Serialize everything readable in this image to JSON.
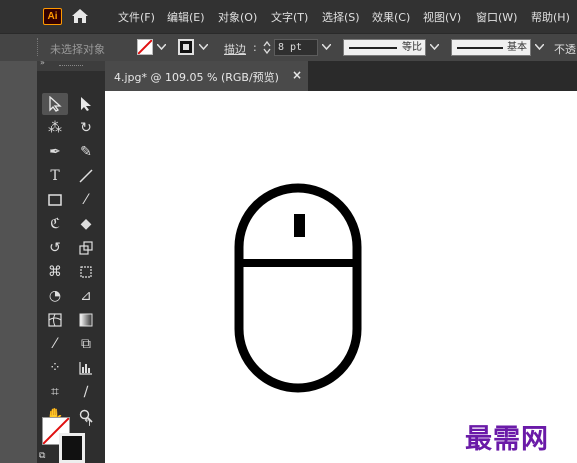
{
  "app": {
    "logo_text": "Ai",
    "brand_color": "#ff9a00"
  },
  "menu": [
    "文件(F)",
    "编辑(E)",
    "对象(O)",
    "文字(T)",
    "选择(S)",
    "效果(C)",
    "视图(V)",
    "窗口(W)",
    "帮助(H)"
  ],
  "controlbar": {
    "selection_status": "未选择对象",
    "stroke_label": "描边",
    "stroke_weight": "8 pt",
    "profile_label": "等比",
    "brush_label": "基本",
    "opacity_label": "不透"
  },
  "toolbar": {
    "grip": "»"
  },
  "document": {
    "tab_title": "4.jpg* @ 109.05 % (RGB/预览)",
    "close_glyph": "×"
  },
  "watermark": "最需网",
  "icons": {
    "home": "home-icon",
    "fill_swatch": "fill-none-swatch",
    "stroke_swatch": "stroke-swatch",
    "canvas_art": "mouse-icon"
  }
}
